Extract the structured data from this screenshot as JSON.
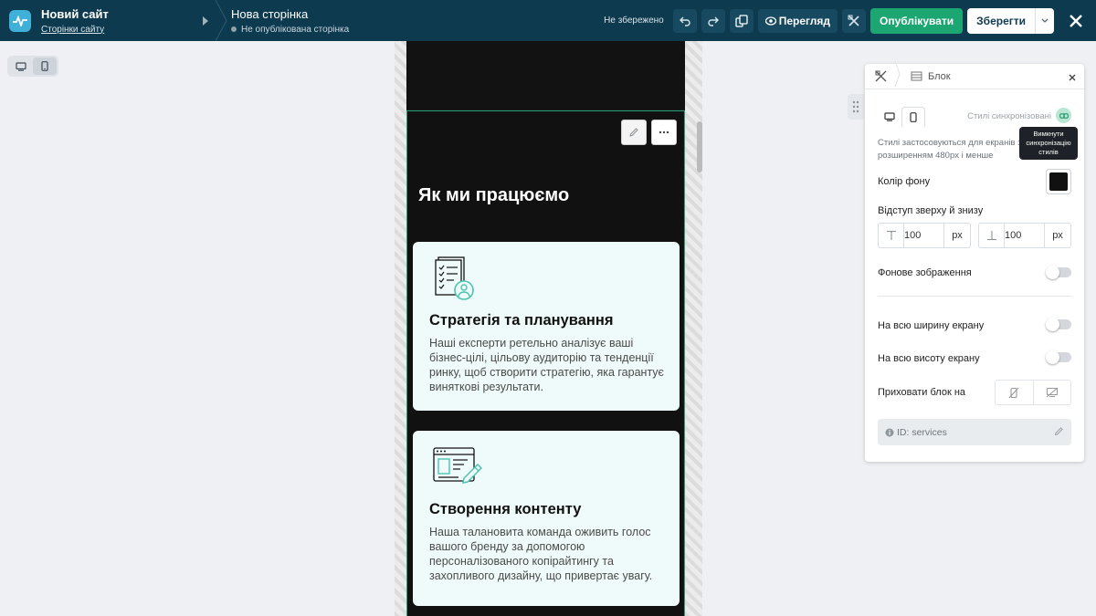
{
  "header": {
    "site_name": "Новий сайт",
    "site_pages_link": "Сторінки сайту",
    "page_name": "Нова сторінка",
    "page_status": "Не опублікована сторінка",
    "unsaved_label": "Не збережено",
    "preview_label": "Перегляд",
    "publish_label": "Опублікувати",
    "save_label": "Зберегти"
  },
  "canvas": {
    "section_title": "Як ми працюємо",
    "cards": [
      {
        "title": "Стратегія та планування",
        "text": "Наші експерти ретельно аналізує ваші бізнес-цілі, цільову аудиторію та тенденції ринку, щоб створити стратегію, яка гарантує виняткові результати.",
        "icon": "document-checklist-person-icon"
      },
      {
        "title": "Створення контенту",
        "text": "Наша талановита команда оживить голос вашого бренду за допомогою персоналізованого копірайтингу та захопливого дизайну, що привертає увагу.",
        "icon": "content-design-pencil-icon"
      }
    ]
  },
  "panel": {
    "title": "Блок",
    "sync_label": "Стилі синхронізовані",
    "tooltip": "Вимкнути синхронізацію стилів",
    "hint": "Стилі застосовуються для екранів з розширенням 480px і менше",
    "bg_color_label": "Колір фону",
    "bg_color_value": "#111111",
    "padding_label": "Відступ зверху й знизу",
    "padding_top": "100",
    "padding_bottom": "100",
    "unit": "px",
    "bg_image_label": "Фонове зображення",
    "full_width_label": "На всю ширину екрану",
    "full_height_label": "На всю висоту екрану",
    "hide_block_label": "Приховати блок на",
    "id_label": "ID: services"
  },
  "colors": {
    "topbar": "#0d3a4f",
    "accent_green": "#1ba672",
    "selection": "#22a079",
    "card_bg": "#effbfa",
    "icon_teal": "#4ec3b0"
  }
}
